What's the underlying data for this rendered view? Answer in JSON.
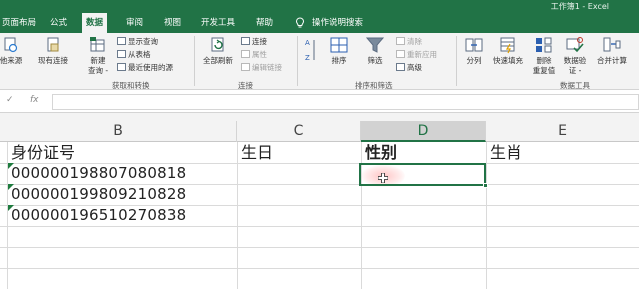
{
  "window": {
    "title": "工作簿1 - Excel"
  },
  "tabs": [
    {
      "label": "页面布局",
      "active": false
    },
    {
      "label": "公式",
      "active": false
    },
    {
      "label": "数据",
      "active": true
    },
    {
      "label": "审阅",
      "active": false
    },
    {
      "label": "视图",
      "active": false
    },
    {
      "label": "开发工具",
      "active": false
    },
    {
      "label": "帮助",
      "active": false
    }
  ],
  "tellme": {
    "placeholder": "操作说明搜索",
    "icon": "lightbulb-icon"
  },
  "ribbon": {
    "groups": [
      {
        "label": "获取和转换",
        "big_buttons": [
          {
            "label": "他来源",
            "icon": "other-sources-icon"
          },
          {
            "label": "现有连接",
            "icon": "existing-connections-icon"
          },
          {
            "label": "新建\n查询 -",
            "icon": "new-query-icon"
          }
        ],
        "small_items": [
          {
            "label": "显示查询",
            "icon": "show-queries-icon",
            "enabled": true
          },
          {
            "label": "从表格",
            "icon": "from-table-icon",
            "enabled": true
          },
          {
            "label": "最近使用的源",
            "icon": "recent-sources-icon",
            "enabled": true
          }
        ]
      },
      {
        "label": "连接",
        "big_buttons": [
          {
            "label": "全部刷新",
            "icon": "refresh-all-icon"
          }
        ],
        "small_items": [
          {
            "label": "连接",
            "icon": "connections-icon",
            "enabled": true
          },
          {
            "label": "属性",
            "icon": "properties-icon",
            "enabled": false
          },
          {
            "label": "编辑链接",
            "icon": "edit-links-icon",
            "enabled": false
          }
        ]
      },
      {
        "label": "排序和筛选",
        "big_buttons": [
          {
            "label": "排序",
            "icon": "sort-icon"
          },
          {
            "label": "筛选",
            "icon": "filter-icon"
          }
        ],
        "small_items": [
          {
            "label": "清除",
            "icon": "clear-icon",
            "enabled": false
          },
          {
            "label": "重新应用",
            "icon": "reapply-icon",
            "enabled": false
          },
          {
            "label": "高级",
            "icon": "advanced-icon",
            "enabled": true
          }
        ]
      },
      {
        "label": "数据工具",
        "big_buttons": [
          {
            "label": "分列",
            "icon": "text-to-columns-icon"
          },
          {
            "label": "快速填充",
            "icon": "flash-fill-icon"
          },
          {
            "label": "删除\n重复值",
            "icon": "remove-duplicates-icon"
          },
          {
            "label": "数据验\n证 -",
            "icon": "data-validation-icon"
          },
          {
            "label": "合并计算",
            "icon": "consolidate-icon"
          }
        ]
      }
    ]
  },
  "formula_bar": {
    "cancel": "✓",
    "fx": "fx",
    "value": ""
  },
  "columns": [
    {
      "label": "B",
      "selected": false
    },
    {
      "label": "C",
      "selected": false
    },
    {
      "label": "D",
      "selected": true
    },
    {
      "label": "E",
      "selected": false
    }
  ],
  "rows": [
    {
      "B": "身份证号",
      "C": "生日",
      "D": "性别",
      "E": "生肖"
    },
    {
      "B": "000000198807080818",
      "C": "",
      "D": "",
      "E": ""
    },
    {
      "B": "000000199809210828",
      "C": "",
      "D": "",
      "E": ""
    },
    {
      "B": "000000196510270838",
      "C": "",
      "D": "",
      "E": ""
    }
  ],
  "selected_cell": "D",
  "colors": {
    "accent": "#217346",
    "selected_header": "#d2d2d2",
    "error_triangle": "#1e7b3e"
  }
}
